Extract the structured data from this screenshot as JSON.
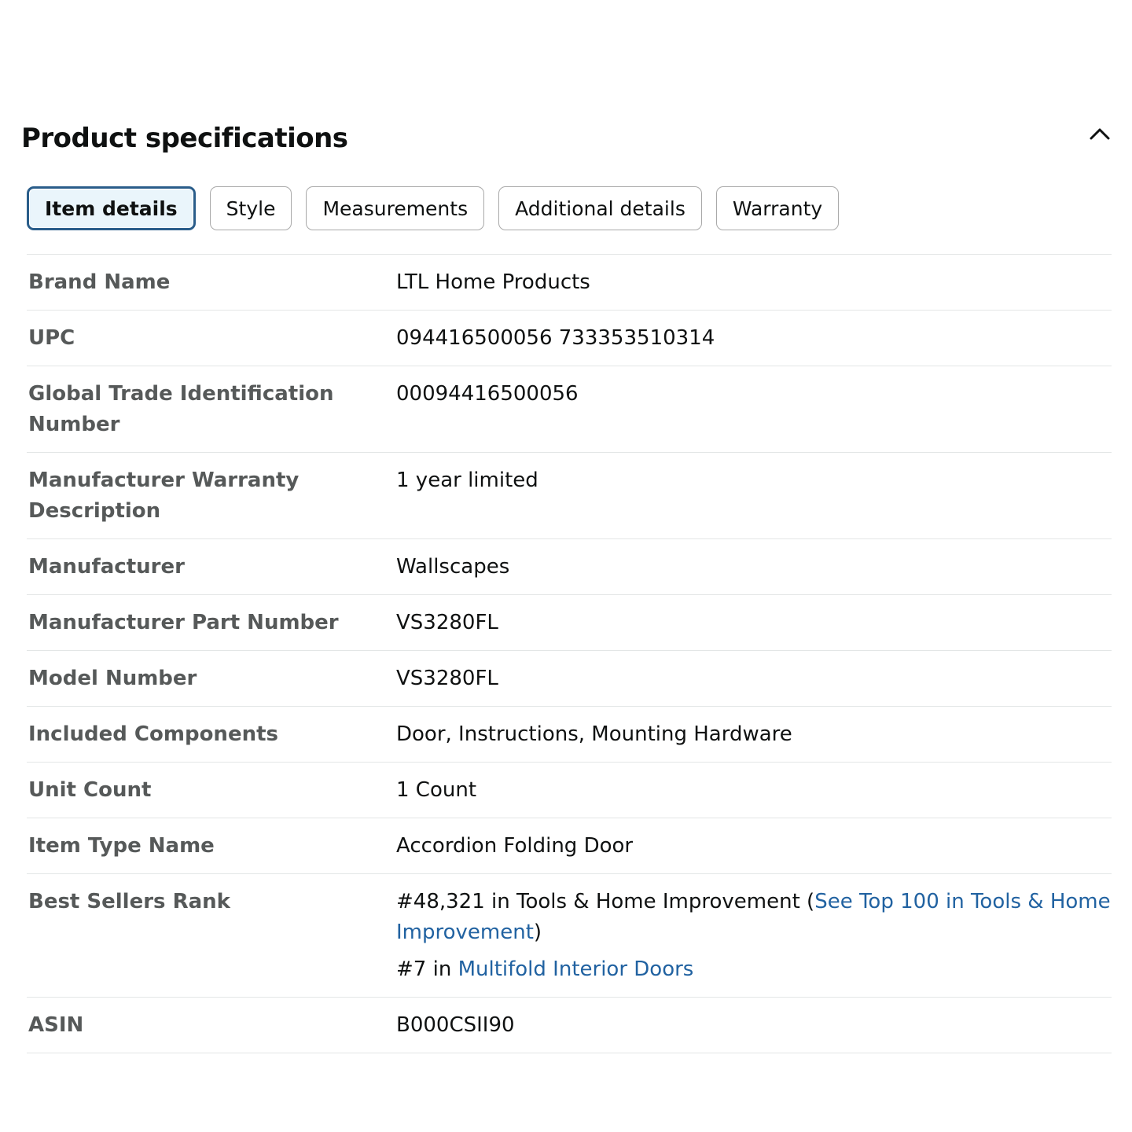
{
  "section": {
    "title": "Product specifications",
    "collapse_icon": "chevron-up-icon"
  },
  "tabs": [
    {
      "label": "Item details",
      "active": true
    },
    {
      "label": "Style",
      "active": false
    },
    {
      "label": "Measurements",
      "active": false
    },
    {
      "label": "Additional details",
      "active": false
    },
    {
      "label": "Warranty",
      "active": false
    }
  ],
  "specs": {
    "brand_name": {
      "label": "Brand Name",
      "value": "LTL Home Products"
    },
    "upc": {
      "label": "UPC",
      "value": "094416500056 733353510314"
    },
    "gtin": {
      "label": "Global Trade Identification Number",
      "value": "00094416500056"
    },
    "warranty_desc": {
      "label": "Manufacturer Warranty Description",
      "value": "1 year limited"
    },
    "manufacturer": {
      "label": "Manufacturer",
      "value": "Wallscapes"
    },
    "part_number": {
      "label": "Manufacturer Part Number",
      "value": "VS3280FL"
    },
    "model_number": {
      "label": "Model Number",
      "value": "VS3280FL"
    },
    "components": {
      "label": "Included Components",
      "value": "Door, Instructions, Mounting Hardware"
    },
    "unit_count": {
      "label": "Unit Count",
      "value": "1 Count"
    },
    "item_type": {
      "label": "Item Type Name",
      "value": "Accordion Folding Door"
    },
    "best_sellers": {
      "label": "Best Sellers Rank",
      "rank1_prefix": "#48,321 in Tools & Home Improvement (",
      "rank1_link": "See Top 100 in Tools & Home Improvement",
      "rank1_suffix": ")",
      "rank2_prefix": "#7 in ",
      "rank2_link": "Multifold Interior Doors"
    },
    "asin": {
      "label": "ASIN",
      "value": "B000CSII90"
    }
  },
  "colors": {
    "link": "#2162a1",
    "active_tab_border": "#2a5d8a",
    "active_tab_bg": "#eaf5fb",
    "label_text": "#565959"
  }
}
